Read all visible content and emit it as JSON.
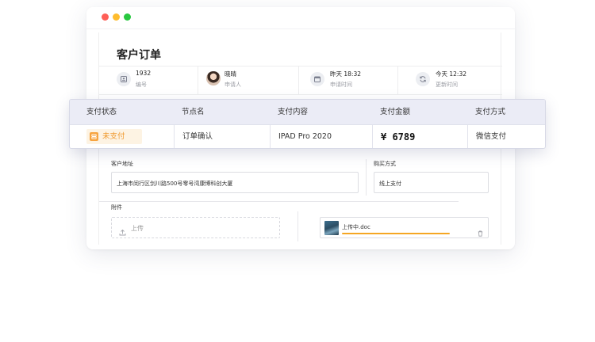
{
  "window": {
    "controls": [
      "close",
      "minimize",
      "maximize"
    ]
  },
  "page": {
    "title": "客户订单"
  },
  "meta": [
    {
      "value": "1932",
      "label": "编号",
      "icon": "id-icon"
    },
    {
      "value": "晓晴",
      "label": "申请人",
      "icon": "avatar"
    },
    {
      "value": "昨天 18:32",
      "label": "申请时间",
      "icon": "calendar-icon"
    },
    {
      "value": "今天 12:32",
      "label": "更新时间",
      "icon": "refresh-icon"
    }
  ],
  "form": {
    "address_label": "客户地址",
    "address_value": "上海市闵行区剑川路500号零号湾康博科创大厦",
    "purchase_label": "购买方式",
    "purchase_value": "线上支付",
    "attachment_label": "附件",
    "upload_label": "上传",
    "file_name": "上传中.doc",
    "upload_progress_percent": 80
  },
  "payment_table": {
    "headers": [
      "支付状态",
      "节点名",
      "支付内容",
      "支付金额",
      "支付方式"
    ],
    "row": {
      "status": "未支付",
      "node": "订单确认",
      "content": "IPAD Pro 2020",
      "amount": "¥ 6789",
      "method": "微信支付"
    }
  },
  "colors": {
    "accent_orange": "#f7a440",
    "status_bg": "#fdf3e3",
    "table_header_bg": "#ebecf6",
    "progress": "#f5a623"
  }
}
